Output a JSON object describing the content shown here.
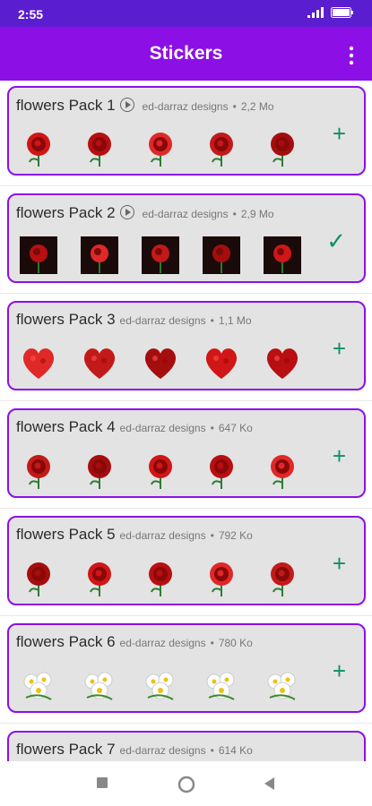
{
  "status": {
    "time": "2:55"
  },
  "appbar": {
    "title": "Stickers"
  },
  "packs": [
    {
      "name": "flowers Pack 1",
      "has_animated": true,
      "publisher": "ed-darraz designs",
      "size": "2,2 Mo",
      "action": "+"
    },
    {
      "name": "flowers Pack 2",
      "has_animated": true,
      "publisher": "ed-darraz designs",
      "size": "2,9 Mo",
      "action": "✓"
    },
    {
      "name": "flowers Pack 3",
      "has_animated": false,
      "publisher": "ed-darraz designs",
      "size": "1,1 Mo",
      "action": "+"
    },
    {
      "name": "flowers Pack 4",
      "has_animated": false,
      "publisher": "ed-darraz designs",
      "size": "647 Ko",
      "action": "+"
    },
    {
      "name": "flowers Pack 5",
      "has_animated": false,
      "publisher": "ed-darraz designs",
      "size": "792 Ko",
      "action": "+"
    },
    {
      "name": "flowers Pack 6",
      "has_animated": false,
      "publisher": "ed-darraz designs",
      "size": "780 Ko",
      "action": "+"
    },
    {
      "name": "flowers Pack 7",
      "has_animated": false,
      "publisher": "ed-darraz designs",
      "size": "614 Ko",
      "action": "+"
    }
  ],
  "colors": {
    "statusbar": "#5a1ed0",
    "appbar": "#8c10e6",
    "accent": "#0e8f6a",
    "card": "#e3e3e3"
  }
}
